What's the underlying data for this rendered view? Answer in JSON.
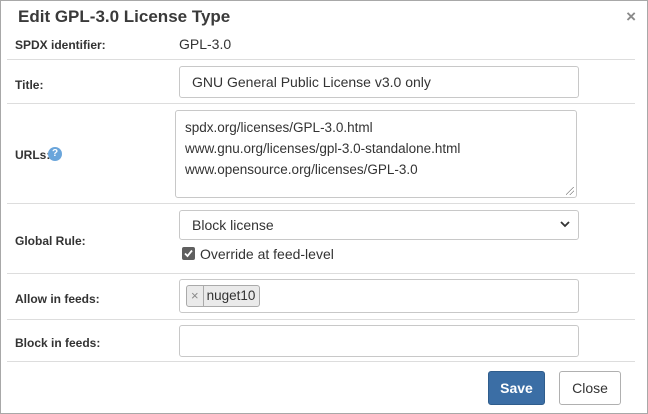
{
  "dialog": {
    "title": "Edit GPL-3.0 License Type",
    "close_glyph": "×"
  },
  "fields": {
    "spdx": {
      "label": "SPDX identifier:",
      "value": "GPL-3.0"
    },
    "title": {
      "label": "Title:",
      "value": "GNU General Public License v3.0 only"
    },
    "urls": {
      "label": "URLs:",
      "help_glyph": "?",
      "lines": [
        "spdx.org/licenses/GPL-3.0.html",
        "www.gnu.org/licenses/gpl-3.0-standalone.html",
        "www.opensource.org/licenses/GPL-3.0"
      ]
    },
    "global_rule": {
      "label": "Global Rule:",
      "selected": "Block license",
      "override_label": "Override at feed-level",
      "override_checked": true
    },
    "allow_feeds": {
      "label": "Allow in feeds:",
      "tags": [
        {
          "remove_glyph": "×",
          "text": "nuget10"
        }
      ]
    },
    "block_feeds": {
      "label": "Block in feeds:",
      "value": ""
    }
  },
  "buttons": {
    "save": "Save",
    "close": "Close"
  },
  "colors": {
    "primary": "#3b6ea5",
    "help": "#6aa5db"
  },
  "icons": [
    "close-icon",
    "help-icon",
    "chevron-down-icon",
    "checkmark-icon",
    "tag-remove-icon",
    "resize-grip-icon"
  ]
}
